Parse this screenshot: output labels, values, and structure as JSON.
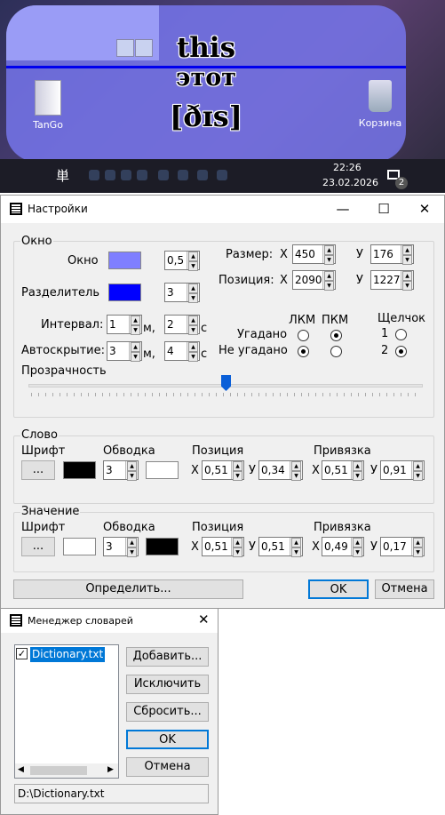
{
  "desktop": {
    "word": "this",
    "translation": "этот",
    "transcription": "[ðɪs]",
    "icon1_label": "TanGo",
    "icon2_label": "Корзина",
    "clock_time": "22:26",
    "clock_date": "23.02.2026",
    "notif_count": "2",
    "taskbar_char": "単"
  },
  "settings": {
    "title": "Настройки",
    "window_group": "Окно",
    "window_label": "Окно",
    "window_color": "#7f7fff",
    "window_opacity": "0,5",
    "divider_label": "Разделитель",
    "divider_color": "#0000ff",
    "divider_value": "3",
    "size_label": "Размер:",
    "size_x_label": "X",
    "size_x": "450",
    "size_y_label": "У",
    "size_y": "176",
    "pos_label": "Позиция:",
    "pos_x_label": "X",
    "pos_x": "2090",
    "pos_y_label": "У",
    "pos_y": "1227",
    "interval_label": "Интервал:",
    "interval_m": "1",
    "m_unit": "м,",
    "interval_s": "2",
    "s_unit": "с",
    "autohide_label": "Автоскрытие:",
    "autohide_m": "3",
    "autohide_s": "4",
    "lkm": "ЛКМ",
    "pkm": "ПКМ",
    "click_label": "Щелчок",
    "guessed": "Угадано",
    "not_guessed": "Не угадано",
    "click1": "1",
    "click2": "2",
    "transparency_label": "Прозрачность",
    "transparency_value": 0.5,
    "word_group": "Слово",
    "font_label": "Шрифт",
    "outline_label": "Обводка",
    "position_label": "Позиция",
    "anchor_label": "Привязка",
    "font_btn": "...",
    "x_label": "X",
    "y_label": "У",
    "word_color": "#000000",
    "word_outline": "3",
    "word_outline_color": "#ffffff",
    "word_pos_x": "0,51",
    "word_pos_y": "0,34",
    "word_anchor_x": "0,51",
    "word_anchor_y": "0,91",
    "meaning_group": "Значение",
    "meaning_color": "#ffffff",
    "meaning_outline": "3",
    "meaning_outline_color": "#000000",
    "meaning_pos_x": "0,51",
    "meaning_pos_y": "0,51",
    "meaning_anchor_x": "0,49",
    "meaning_anchor_y": "0,17",
    "define_btn": "Определить...",
    "ok_btn": "OK",
    "cancel_btn": "Отмена"
  },
  "dict": {
    "title": "Менеджер словарей",
    "items": [
      "Dictionary.txt"
    ],
    "add_btn": "Добавить...",
    "exclude_btn": "Исключить",
    "reset_btn": "Сбросить...",
    "ok_btn": "OK",
    "cancel_btn": "Отмена",
    "path": "D:\\Dictionary.txt"
  }
}
